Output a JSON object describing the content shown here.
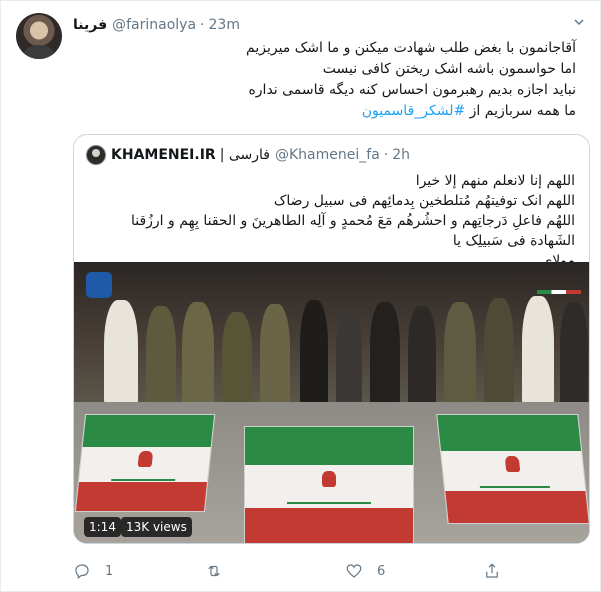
{
  "tweet": {
    "author_name": "فرينا",
    "author_handle": "@farinaolya",
    "separator": "·",
    "time": "23m",
    "text_lines": [
      "آقاجانمون با بغض طلب شهادت میکنن و ما اشک میریزیم",
      "اما حواسمون باشه اشک ریختن کافی نیست",
      "نباید اجازه بدیم رهبرمون احساس کنه دیگه قاسمی نداره"
    ],
    "last_line_prefix": "ما همه سربازیم از ",
    "hashtag": "#لشکر_قاسمیون"
  },
  "quoted": {
    "name": "KHAMENEI.IR",
    "name_suffix": "| فارسی",
    "handle": "@Khamenei_fa",
    "separator": "·",
    "time": "2h",
    "text_lines": [
      "اللهم إنا لانعلم منهم إلا خيرا",
      "اللهم انک توفیتهُم مُتلطخین بِدمائِهم فی سبیل رضاک",
      "اللهُم فاعلِ دَرجاتِهم و احشُرهُم مَعَ مُحمدٍ و آلِه الطاهرینَ و الحقنا بِهِم و ارزُقنا الشَهادة فی سَبیلِک یا",
      "مولای..."
    ],
    "video": {
      "duration": "1:14",
      "views": "13K views"
    }
  },
  "actions": {
    "reply_count": "1",
    "retweet_count": "",
    "like_count": "6"
  },
  "colors": {
    "link": "#1da1f2",
    "muted": "#657786",
    "border": "#e6ecf0"
  }
}
